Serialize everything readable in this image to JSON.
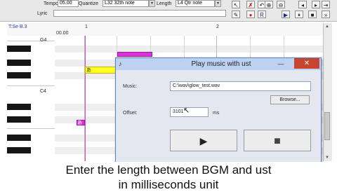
{
  "toolbar": {
    "tempo_label": "Tempo",
    "tempo_value": "05.00",
    "quantize_label": "Quantize",
    "quantize_value": "L32 32th note",
    "length_label": "Length",
    "length_value": "L4 Qtr note",
    "lyric_label": "Lyric",
    "buttons": [
      "▶",
      "⏸",
      "■"
    ]
  },
  "ruler": {
    "track_label": "T:Se B.3",
    "time_label": "00.00",
    "measures": [
      "1",
      "2"
    ]
  },
  "piano": {
    "note_labels": [
      "G4",
      "C4"
    ]
  },
  "notes": {
    "yellow_lyric": "あ",
    "magenta2_lyric": "あ"
  },
  "dialog": {
    "title": "Play music with ust",
    "music_label": "Music:",
    "music_value": "C:\\wav\\glow_test.wav",
    "browse_label": "Browse...",
    "offset_label": "Offset:",
    "offset_value": "3101",
    "offset_unit": "ms",
    "play_icon": "▶",
    "stop_icon": "■",
    "close_icon": "✕",
    "minimize_icon": "—"
  },
  "caption": {
    "line1": "Enter the length between BGM and ust",
    "line2": "in milliseconds unit"
  }
}
